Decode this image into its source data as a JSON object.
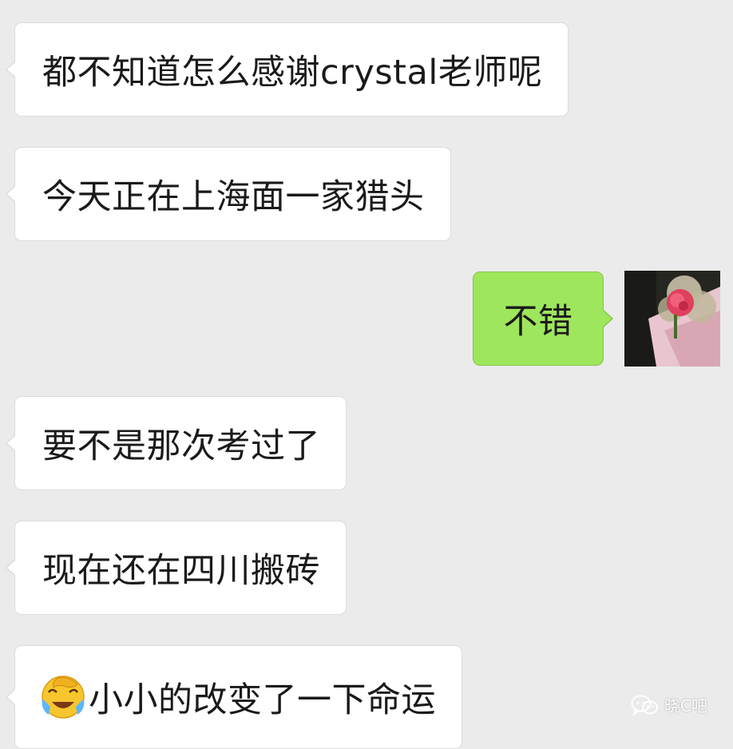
{
  "messages": [
    {
      "side": "received",
      "text": "都不知道怎么感谢crystal老师呢"
    },
    {
      "side": "received",
      "text": "今天正在上海面一家猎头"
    },
    {
      "side": "sent",
      "text": "不错"
    },
    {
      "side": "received",
      "text": "要不是那次考过了"
    },
    {
      "side": "received",
      "text": "现在还在四川搬砖"
    },
    {
      "side": "received",
      "emoji": "face-palm-laughing-emoji",
      "text": "小小的改变了一下命运"
    }
  ],
  "sent_avatar": {
    "icon": "rose-photo-avatar"
  },
  "watermark": {
    "icon": "wechat-icon",
    "text": "晓C吧"
  },
  "colors": {
    "background": "#ebebeb",
    "received_bubble": "#ffffff",
    "sent_bubble": "#9ee65c"
  }
}
